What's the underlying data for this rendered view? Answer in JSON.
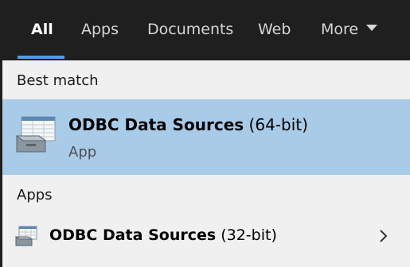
{
  "tabs": [
    {
      "label": "All",
      "active": true
    },
    {
      "label": "Apps"
    },
    {
      "label": "Documents"
    },
    {
      "label": "Web"
    },
    {
      "label": "More"
    }
  ],
  "sections": {
    "best_match": {
      "heading": "Best match",
      "item": {
        "title_bold": "ODBC Data Sources",
        "title_suffix": " (64-bit)",
        "subtitle": "App",
        "icon": "odbc-database-icon"
      }
    },
    "apps": {
      "heading": "Apps",
      "items": [
        {
          "title_bold": "ODBC Data Sources",
          "title_suffix": " (32-bit)",
          "icon": "odbc-database-icon",
          "chevron": "chevron-right-icon"
        }
      ]
    }
  },
  "colors": {
    "header_bg": "#1f1f1f",
    "accent": "#4c9ee8",
    "selected_row": "#a8cbe8",
    "panel_bg": "#f0f0f0"
  }
}
